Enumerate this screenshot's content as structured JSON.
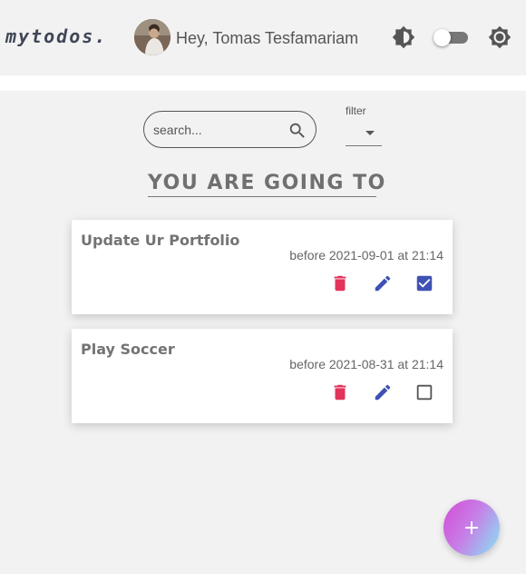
{
  "header": {
    "logo": "mytodos.",
    "greeting": "Hey, Tomas Tesfamariam",
    "icons": [
      "brightness-icon",
      "theme-toggle",
      "settings-icon"
    ]
  },
  "search": {
    "placeholder": "search..."
  },
  "filter": {
    "label": "filter",
    "selected": ""
  },
  "section": {
    "title": "YOU ARE GOING TO"
  },
  "todos": [
    {
      "title": "Update Ur Portfolio",
      "due": "before 2021-09-01 at 21:14",
      "completed": true
    },
    {
      "title": "Play Soccer",
      "due": "before 2021-08-31 at 21:14",
      "completed": false
    }
  ],
  "colors": {
    "delete": "#e2345b",
    "edit": "#3f51b5",
    "check": "#3f51b5",
    "text": "#737373"
  }
}
